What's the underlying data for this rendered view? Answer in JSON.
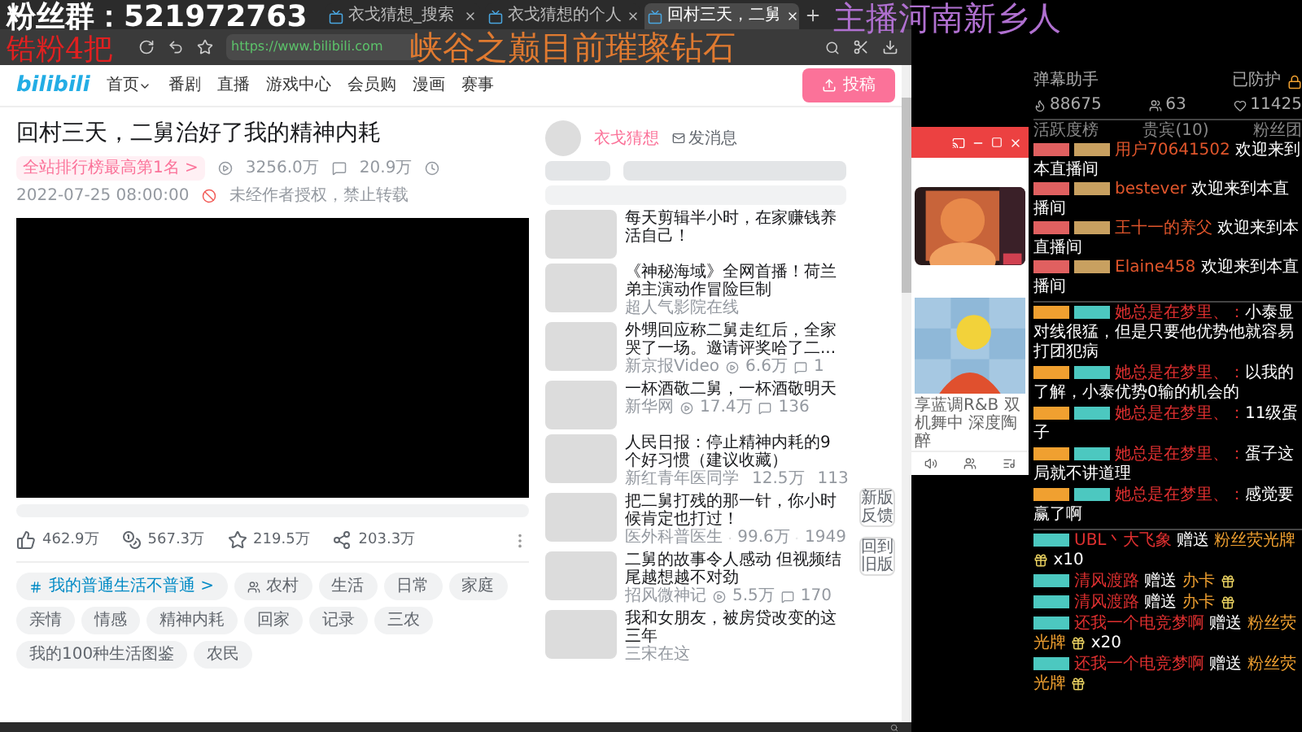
{
  "overlays": {
    "fan_group": "粉丝群：521972763",
    "rank_note": "锆粉4把",
    "rank": "峡谷之巅目前璀璨钻石",
    "host": "主播河南新乡人"
  },
  "browser": {
    "tabs": [
      {
        "label": "衣戈猜想_搜索",
        "selected": false
      },
      {
        "label": "衣戈猜想的个人",
        "selected": false
      },
      {
        "label": "回村三天，二舅",
        "selected": true
      }
    ],
    "url": "https://www.bilibili.com"
  },
  "site": {
    "logo": "bilibili",
    "nav": [
      "首页",
      "番剧",
      "直播",
      "游戏中心",
      "会员购",
      "漫画",
      "赛事"
    ],
    "upload": "投稿"
  },
  "video": {
    "title": "回村三天，二舅治好了我的精神内耗",
    "rank_badge": "全站排行榜最高第1名 >",
    "plays": "3256.0万",
    "danmaku": "20.9万",
    "date": "2022-07-25 08:00:00",
    "notice": "未经作者授权，禁止转载",
    "actions": [
      {
        "kind": "like",
        "count": "462.9万"
      },
      {
        "kind": "coin",
        "count": "567.3万"
      },
      {
        "kind": "favorite",
        "count": "219.5万"
      },
      {
        "kind": "share",
        "count": "203.3万"
      }
    ],
    "tags": [
      {
        "kind": "topic",
        "label": "我的普通生活不普通 >"
      },
      {
        "kind": "channel",
        "label": "农村"
      },
      {
        "kind": "tag",
        "label": "生活"
      },
      {
        "kind": "tag",
        "label": "日常"
      },
      {
        "kind": "tag",
        "label": "家庭"
      },
      {
        "kind": "tag",
        "label": "亲情"
      },
      {
        "kind": "tag",
        "label": "情感"
      },
      {
        "kind": "tag",
        "label": "精神内耗"
      },
      {
        "kind": "tag",
        "label": "回家"
      },
      {
        "kind": "tag",
        "label": "记录"
      },
      {
        "kind": "tag",
        "label": "三农"
      },
      {
        "kind": "tag",
        "label": "我的100种生活图鉴"
      },
      {
        "kind": "tag",
        "label": "农民"
      }
    ]
  },
  "uploader": {
    "name": "衣戈猜想",
    "message": "发消息"
  },
  "recommendations": [
    {
      "title": "每天剪辑半小时，在家赚钱养活自己！"
    },
    {
      "title": "《神秘海域》全网首播！荷兰弟主演动作冒险巨制",
      "author": "超人气影院在线"
    },
    {
      "title": "外甥回应称二舅走红后，全家哭了一场。邀请评奖哈了二...",
      "author": "新京报Video",
      "views": "6.6万",
      "comments": "1"
    },
    {
      "title": "一杯酒敬二舅，一杯酒敬明天",
      "author": "新华网",
      "views": "17.4万",
      "comments": "136"
    },
    {
      "title": "人民日报：停止精神内耗的9个好习惯（建议收藏）",
      "author": "新红青年医同学",
      "views": "12.5万",
      "comments": "113"
    },
    {
      "title": "把二舅打残的那一针，你小时候肯定也打过！",
      "author": "医外科普医生",
      "views": "99.6万",
      "comments": "1949"
    },
    {
      "title": "二舅的故事令人感动 但视频结尾越想越不对劲",
      "author": "招风微神记",
      "views": "5.5万",
      "comments": "170"
    },
    {
      "title": "我和女朋友，被房贷改变的这三年",
      "author": "三宋在这"
    }
  ],
  "side_buttons": [
    "新版反馈",
    "回到旧版"
  ],
  "player_popup": {
    "caption": "享蓝调R&B 双机舞中 深度陶醉"
  },
  "chat": {
    "title": "弹幕助手",
    "protection": "已防护",
    "stats": [
      {
        "kind": "popularity",
        "value": "88675"
      },
      {
        "kind": "fans",
        "value": "63"
      },
      {
        "kind": "likes",
        "value": "11425"
      }
    ],
    "columns": [
      "活跃度榜",
      "贵宾(10)",
      "粉丝团"
    ],
    "welcomes": [
      {
        "user": "用户70641502",
        "text": "欢迎来到本直播间"
      },
      {
        "user": "bestever",
        "text": "欢迎来到本直播间"
      },
      {
        "user": "王十一的养父",
        "text": "欢迎来到本直播间"
      },
      {
        "user": "Elaine458",
        "text": "欢迎来到本直播间"
      }
    ],
    "messages": [
      {
        "user": "她总是在梦里、：",
        "text": "小泰显对线很猛，但是只要他优势他就容易打团犯病"
      },
      {
        "user": "她总是在梦里、：",
        "text": "以我的了解，小泰优势0输的机会的"
      },
      {
        "user": "她总是在梦里、：",
        "text": "11级蛋子"
      },
      {
        "user": "她总是在梦里、：",
        "text": "蛋子这局就不讲道理"
      },
      {
        "user": "她总是在梦里、：",
        "text": "感觉要赢了啊"
      }
    ],
    "gifts": [
      {
        "user": "UBL丶大飞象",
        "action": "赠送",
        "gift": "粉丝荧光牌",
        "count": "x10"
      },
      {
        "user": "清风渡路",
        "action": "赠送",
        "gift": "办卡"
      },
      {
        "user": "清风渡路",
        "action": "赠送",
        "gift": "办卡"
      },
      {
        "user": "还我一个电竞梦啊",
        "action": "赠送",
        "gift": "粉丝荧光牌",
        "count": "x20"
      },
      {
        "user": "还我一个电竞梦啊",
        "action": "赠送",
        "gift": "粉丝荧光牌"
      }
    ]
  }
}
